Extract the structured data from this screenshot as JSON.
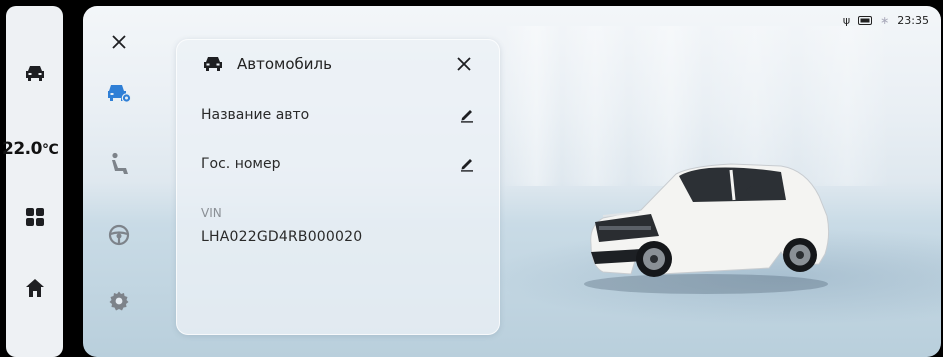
{
  "status_bar": {
    "time": "23:35"
  },
  "left_rail": {
    "temperature_value": "22.0",
    "temperature_unit": "°C",
    "icons": [
      "car-icon",
      "apps-grid-icon",
      "home-icon"
    ]
  },
  "side_menu": {
    "items": [
      "close-icon",
      "vehicle-settings-icon",
      "seat-icon",
      "steering-wheel-icon",
      "gear-icon"
    ],
    "active": "vehicle-settings-icon",
    "accent_color": "#2f7fd6"
  },
  "panel": {
    "title": "Автомобиль",
    "rows": [
      {
        "label": "Название авто"
      },
      {
        "label": "Гос. номер"
      }
    ],
    "vin_label": "VIN",
    "vin_value": "LHA022GD4RB000020"
  }
}
